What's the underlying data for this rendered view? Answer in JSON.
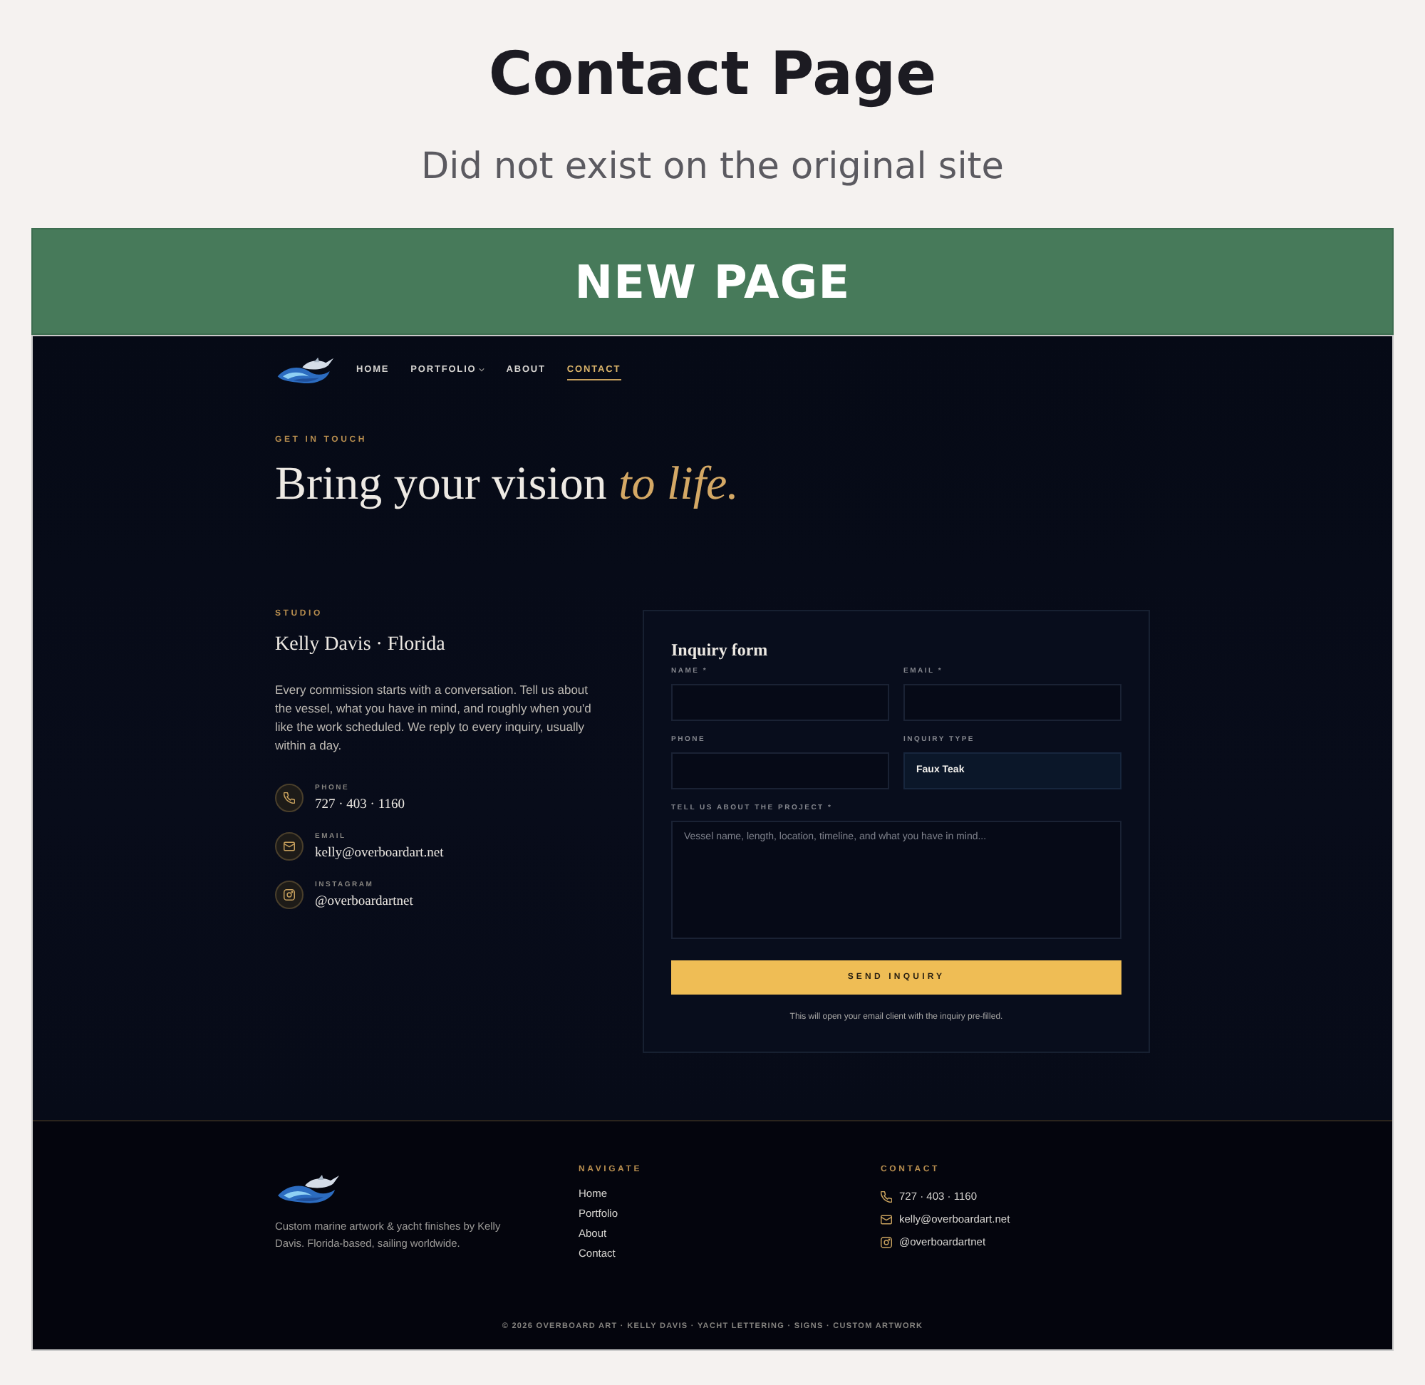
{
  "header": {
    "title": "Contact Page",
    "subtitle": "Did not exist on the original site"
  },
  "banner": {
    "label": "NEW PAGE"
  },
  "site": {
    "nav": {
      "links": [
        {
          "label": "HOME",
          "kind": "link",
          "selected": false
        },
        {
          "label": "PORTFOLIO",
          "kind": "dropdown",
          "selected": false
        },
        {
          "label": "ABOUT",
          "kind": "link",
          "selected": false
        },
        {
          "label": "CONTACT",
          "kind": "link",
          "selected": true
        }
      ]
    },
    "hero": {
      "eyebrow": "GET IN TOUCH",
      "heading": "Bring your vision *to life.*"
    },
    "studio": {
      "eyebrow": "STUDIO",
      "name": "Kelly Davis · Florida",
      "intro": "Every commission starts with a conversation. Tell us about the vessel, what you have in mind, and roughly when you'd like the work scheduled. We reply to every inquiry, usually within a day.",
      "contacts": [
        {
          "kind": "phone",
          "label": "PHONE",
          "value": "727 · 403 · 1160"
        },
        {
          "kind": "email",
          "label": "EMAIL",
          "value": "kelly@overboardart.net"
        },
        {
          "kind": "instagram",
          "label": "INSTAGRAM",
          "value": "@overboardartnet"
        }
      ]
    },
    "form": {
      "title": "Inquiry form",
      "fields": [
        {
          "kind": "text",
          "label": "NAME *"
        },
        {
          "kind": "text",
          "label": "EMAIL *"
        },
        {
          "kind": "text",
          "label": "PHONE"
        },
        {
          "kind": "select",
          "label": "INQUIRY TYPE",
          "value": "Faux Teak"
        },
        {
          "kind": "textarea",
          "label": "TELL US ABOUT THE PROJECT *",
          "placeholder": "Vessel name, length, location, timeline, and what you have in mind..."
        }
      ],
      "submit": "SEND INQUIRY",
      "note": "This will open your email client with the inquiry pre-filled."
    }
  },
  "footer": {
    "tagline": "Custom marine artwork & yacht finishes by Kelly Davis. Florida-based, sailing worldwide.",
    "navigate": {
      "heading": "NAVIGATE",
      "links": [
        "Home",
        "Portfolio",
        "About",
        "Contact"
      ]
    },
    "contact": {
      "heading": "CONTACT",
      "items": [
        {
          "kind": "phone",
          "value": "727 · 403 · 1160"
        },
        {
          "kind": "email",
          "value": "kelly@overboardart.net"
        },
        {
          "kind": "instagram",
          "value": "@overboardartnet"
        }
      ]
    },
    "copyright": "© 2026 OVERBOARD ART · KELLY DAVIS · YACHT LETTERING · SIGNS · CUSTOM ARTWORK"
  }
}
